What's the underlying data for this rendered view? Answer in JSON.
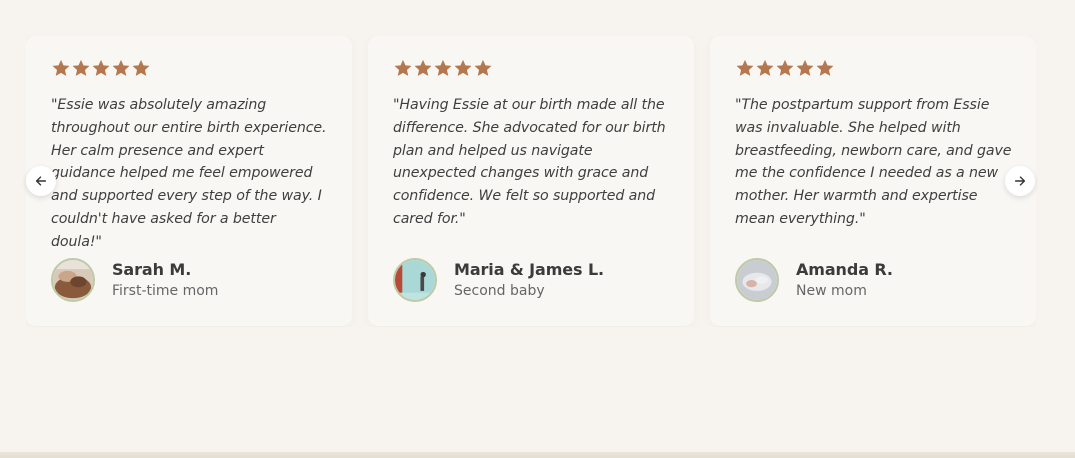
{
  "colors": {
    "star": "#b5774e",
    "background": "#f7f4ef",
    "card": "#f9f7f3",
    "avatar_ring": "#bccaa6"
  },
  "icons": {
    "star": "star-icon",
    "prev": "arrow-left-icon",
    "next": "arrow-right-icon"
  },
  "testimonials": [
    {
      "rating": 5,
      "quote": "\"Essie was absolutely amazing throughout our entire birth experience. Her calm presence and expert guidance helped me feel empowered and supported every step of the way. I couldn't have asked for a better doula!\"",
      "name": "Sarah M.",
      "role": "First-time mom"
    },
    {
      "rating": 5,
      "quote": "\"Having Essie at our birth made all the difference. She advocated for our birth plan and helped us navigate unexpected changes with grace and confidence. We felt so supported and cared for.\"",
      "name": "Maria & James L.",
      "role": "Second baby"
    },
    {
      "rating": 5,
      "quote": "\"The postpartum support from Essie was invaluable. She helped with breastfeeding, newborn care, and gave me the confidence I needed as a new mother. Her warmth and expertise mean everything.\"",
      "name": "Amanda R.",
      "role": "New mom"
    }
  ]
}
